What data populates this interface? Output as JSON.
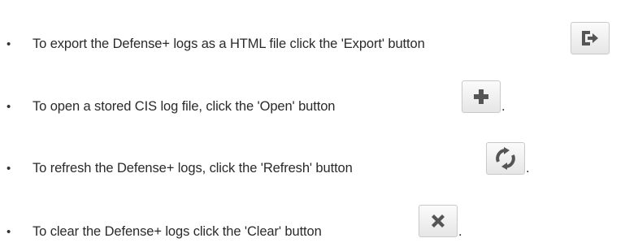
{
  "items": [
    {
      "bullet": "•",
      "text": "To export the Defense+ logs as a HTML file click the 'Export' button",
      "button_icon": "export-icon",
      "suffix": ""
    },
    {
      "bullet": "•",
      "text": "To open a stored CIS log file, click the 'Open' button",
      "button_icon": "plus-icon",
      "suffix": "."
    },
    {
      "bullet": "•",
      "text": "To refresh the Defense+ logs, click the 'Refresh' button",
      "button_icon": "refresh-icon",
      "suffix": "."
    },
    {
      "bullet": "•",
      "text": "To clear the Defense+ logs click the 'Clear' button",
      "button_icon": "close-icon",
      "suffix": "."
    }
  ],
  "colors": {
    "icon": "#555555",
    "text": "#2a2a2a"
  }
}
